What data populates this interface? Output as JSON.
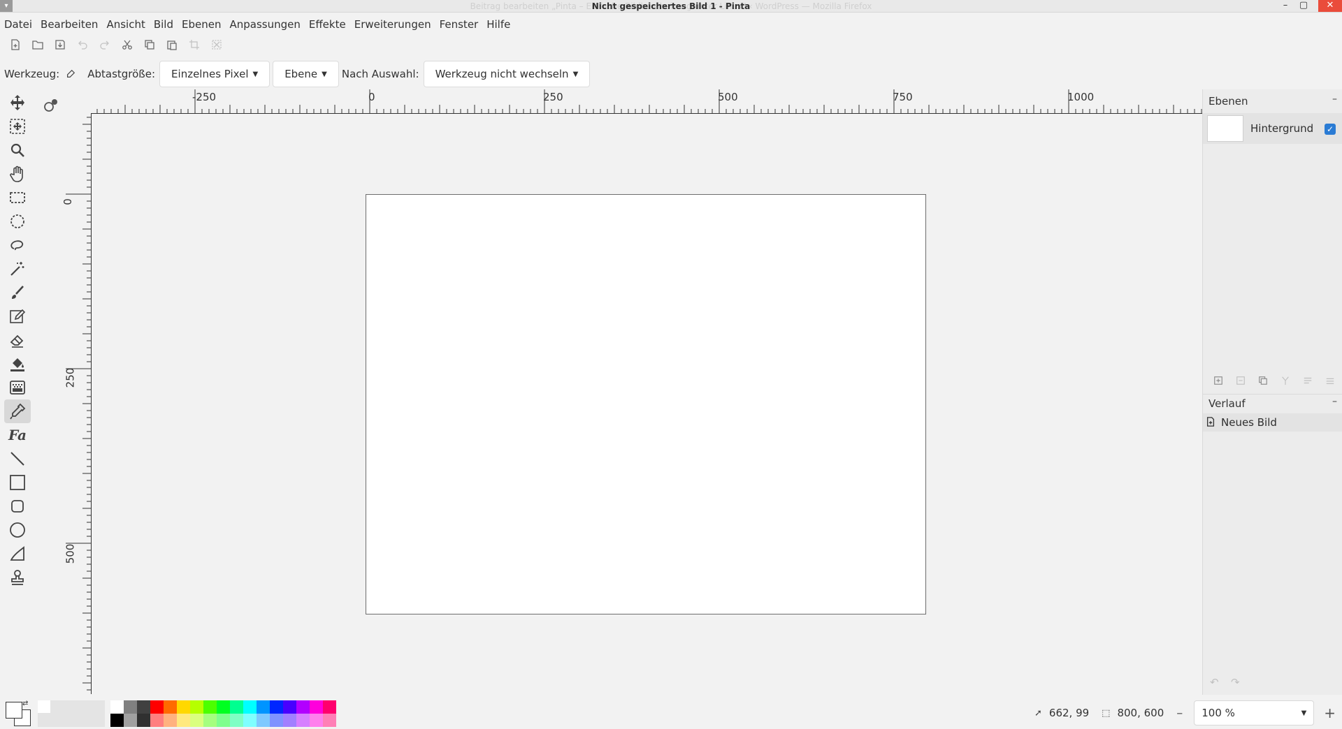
{
  "window": {
    "ghost_title": "Beitrag bearbeiten „Pinta – Einfache Bildbearbeitung unter Linux“ ‹ WordPress — Mozilla Firefox",
    "title": "Nicht gespeichertes Bild 1 - Pinta",
    "minimize": "–",
    "maximize": "▢",
    "close": "✕"
  },
  "menu": [
    "Datei",
    "Bearbeiten",
    "Ansicht",
    "Bild",
    "Ebenen",
    "Anpassungen",
    "Effekte",
    "Erweiterungen",
    "Fenster",
    "Hilfe"
  ],
  "toolbar": {
    "buttons": [
      {
        "icon": "new-image-icon",
        "enabled": true
      },
      {
        "icon": "open-icon",
        "enabled": true
      },
      {
        "icon": "save-icon",
        "enabled": true
      },
      {
        "icon": "undo-icon",
        "enabled": false
      },
      {
        "icon": "redo-icon",
        "enabled": false
      },
      {
        "icon": "cut-icon",
        "enabled": true
      },
      {
        "icon": "copy-icon",
        "enabled": true
      },
      {
        "icon": "paste-icon",
        "enabled": true
      },
      {
        "icon": "crop-icon",
        "enabled": false
      },
      {
        "icon": "deselect-icon",
        "enabled": false
      }
    ]
  },
  "options": {
    "tool_label": "Werkzeug:",
    "sample_label": "Abtastgröße:",
    "sample_value": "Einzelnes Pixel",
    "layer_value": "Ebene",
    "after_label": "Nach Auswahl:",
    "after_value": "Werkzeug nicht wechseln"
  },
  "tools": [
    "move-selected-icon",
    "move-selection-icon",
    "zoom-icon",
    "pan-icon",
    "rectangle-select-icon",
    "ellipse-select-icon",
    "lasso-select-icon",
    "magic-wand-icon",
    "paintbrush-icon",
    "pencil-icon",
    "eraser-icon",
    "paint-bucket-icon",
    "gradient-icon",
    "color-picker-icon",
    "text-icon",
    "line-icon",
    "rectangle-icon",
    "rounded-rectangle-icon",
    "ellipse-icon",
    "freeform-shape-icon",
    "clone-stamp-icon"
  ],
  "active_tool": "color-picker-icon",
  "rulers": {
    "h_labels": [
      "-250",
      "0",
      "250",
      "500",
      "750",
      "1000"
    ],
    "v_labels": [
      "0",
      "250",
      "500"
    ]
  },
  "layers_panel": {
    "title": "Ebenen",
    "collapse": "–",
    "layer_name": "Hintergrund",
    "visible_check": "✓"
  },
  "history_panel": {
    "title": "Verlauf",
    "collapse": "–",
    "item": "Neues Bild",
    "undo": "↶",
    "redo": "↷"
  },
  "palette": {
    "top_row": [
      "#ffffff",
      "#808080",
      "#404040",
      "#ff0000",
      "#ff6a00",
      "#ffd800",
      "#b6ff00",
      "#4cff00",
      "#00ff21",
      "#00ff90",
      "#00ffff",
      "#0094ff",
      "#0026ff",
      "#4800ff",
      "#b200ff",
      "#ff00dc",
      "#ff006e"
    ],
    "bottom_row": [
      "#000000",
      "#a0a0a0",
      "#303030",
      "#ff7f7f",
      "#ffb27f",
      "#ffe97f",
      "#daff7f",
      "#a5ff7f",
      "#7fff8e",
      "#7fffc5",
      "#7fffff",
      "#7fc9ff",
      "#7f92ff",
      "#a17fff",
      "#d67fff",
      "#ff7fed",
      "#ff7fb6"
    ]
  },
  "status": {
    "cursor_pos": "662, 99",
    "selection_size": "800, 600",
    "zoom_minus": "–",
    "zoom_value": "100 %",
    "zoom_plus": "+"
  }
}
